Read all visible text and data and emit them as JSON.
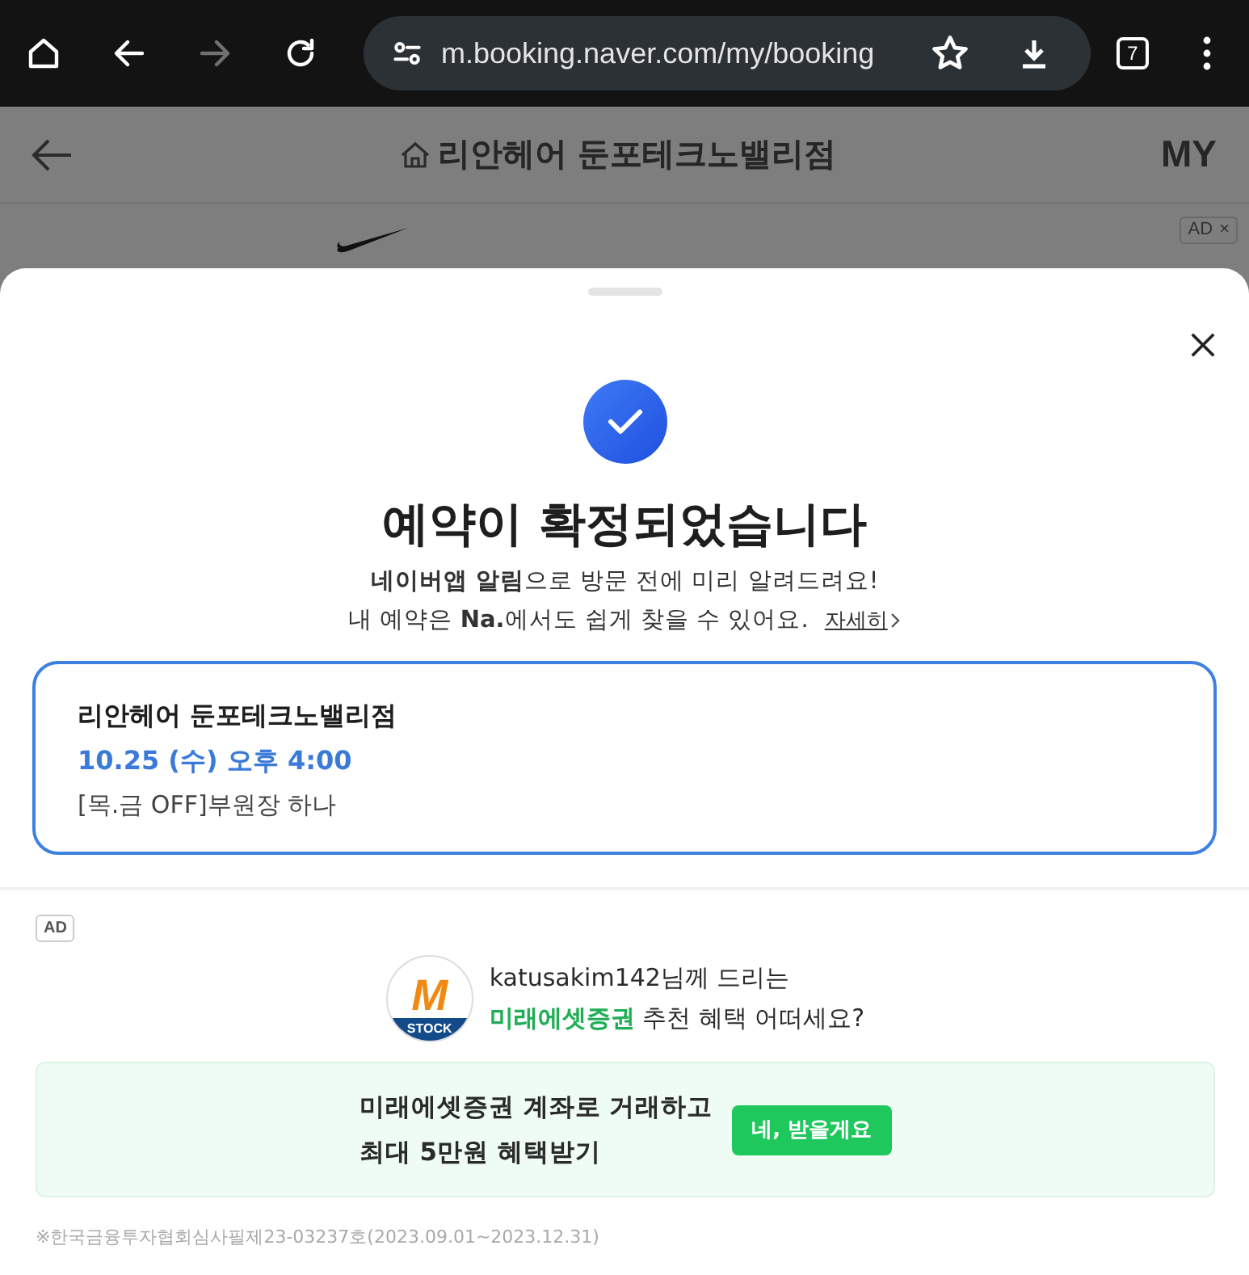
{
  "browser": {
    "url": "m.booking.naver.com/my/booking",
    "forward_disabled": true,
    "tab_count": "7"
  },
  "app_header": {
    "title": "리안헤어 둔포테크노밸리점",
    "right_label": "MY"
  },
  "background_ad": {
    "badge": "AD",
    "close": "×"
  },
  "sheet": {
    "title": "예약이 확정되었습니다",
    "messages": [
      "**네이버앱 알림**으로 방문 전에 미리 알려드려요!",
      "내 예약은 **Na.**에서도 쉽게 찾을 수 있어요."
    ],
    "link": "자세히",
    "booking": {
      "shop": "리안헤어 둔포테크노밸리점",
      "datetime": "10.25 (수) 오후 4:00",
      "service": "[목.금 OFF]부원장 하나"
    },
    "ad": {
      "badge": "AD",
      "logo_letter": "M",
      "logo_caption": "STOCK",
      "greeting": "katusakim142님께 드리는",
      "advertiser": "미래에셋증권",
      "question": " 추천 혜택 어떠세요?",
      "offer_lines": [
        "미래에셋증권 계좌로 거래하고",
        "최대 5만원 혜택받기"
      ],
      "button": "네, 받을게요",
      "disclaimer": "※한국금융투자협회심사필제23-03237호(2023.09.01~2023.12.31)"
    }
  }
}
